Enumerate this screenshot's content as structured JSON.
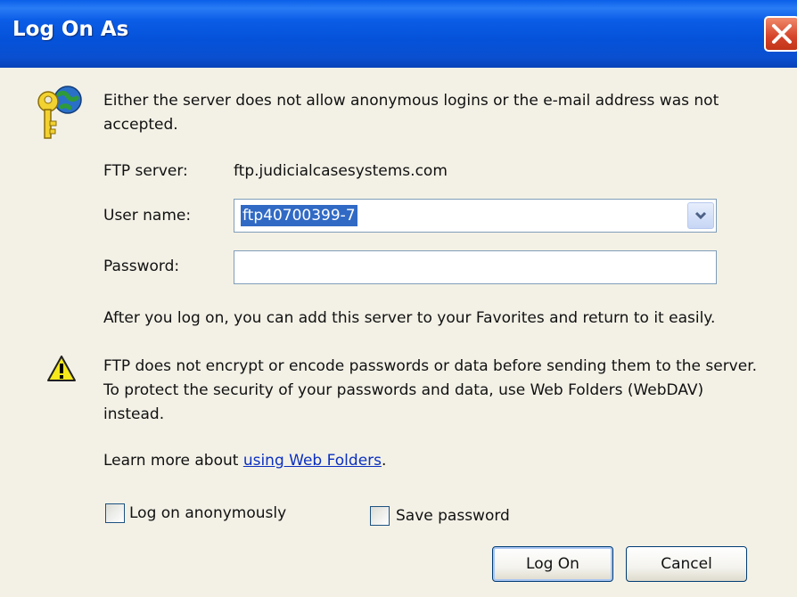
{
  "window": {
    "title": "Log On As"
  },
  "message": "Either the server does not allow anonymous logins or the e-mail address was not accepted.",
  "ftp_server": {
    "label": "FTP server:",
    "value": "ftp.judicialcasesystems.com"
  },
  "user_name": {
    "label": "User name:",
    "value": "ftp40700399-7"
  },
  "password": {
    "label": "Password:",
    "value": ""
  },
  "favorites_note": "After you log on, you can add this server to your Favorites and return to it easily.",
  "warning": "FTP does not encrypt or encode passwords or data before sending them to the server.  To protect the security of your passwords and data, use Web Folders (WebDAV) instead.",
  "learn_more": {
    "prefix": "Learn more about ",
    "link": "using Web Folders",
    "suffix": "."
  },
  "checkboxes": {
    "anonymous": {
      "label": "Log on anonymously",
      "checked": false
    },
    "save_password": {
      "label": "Save password",
      "checked": false
    }
  },
  "buttons": {
    "log_on": "Log On",
    "cancel": "Cancel"
  },
  "icons": {
    "header": "keys-globe-icon",
    "warning": "warning-icon",
    "close": "close-icon",
    "dropdown": "chevron-down-icon"
  }
}
